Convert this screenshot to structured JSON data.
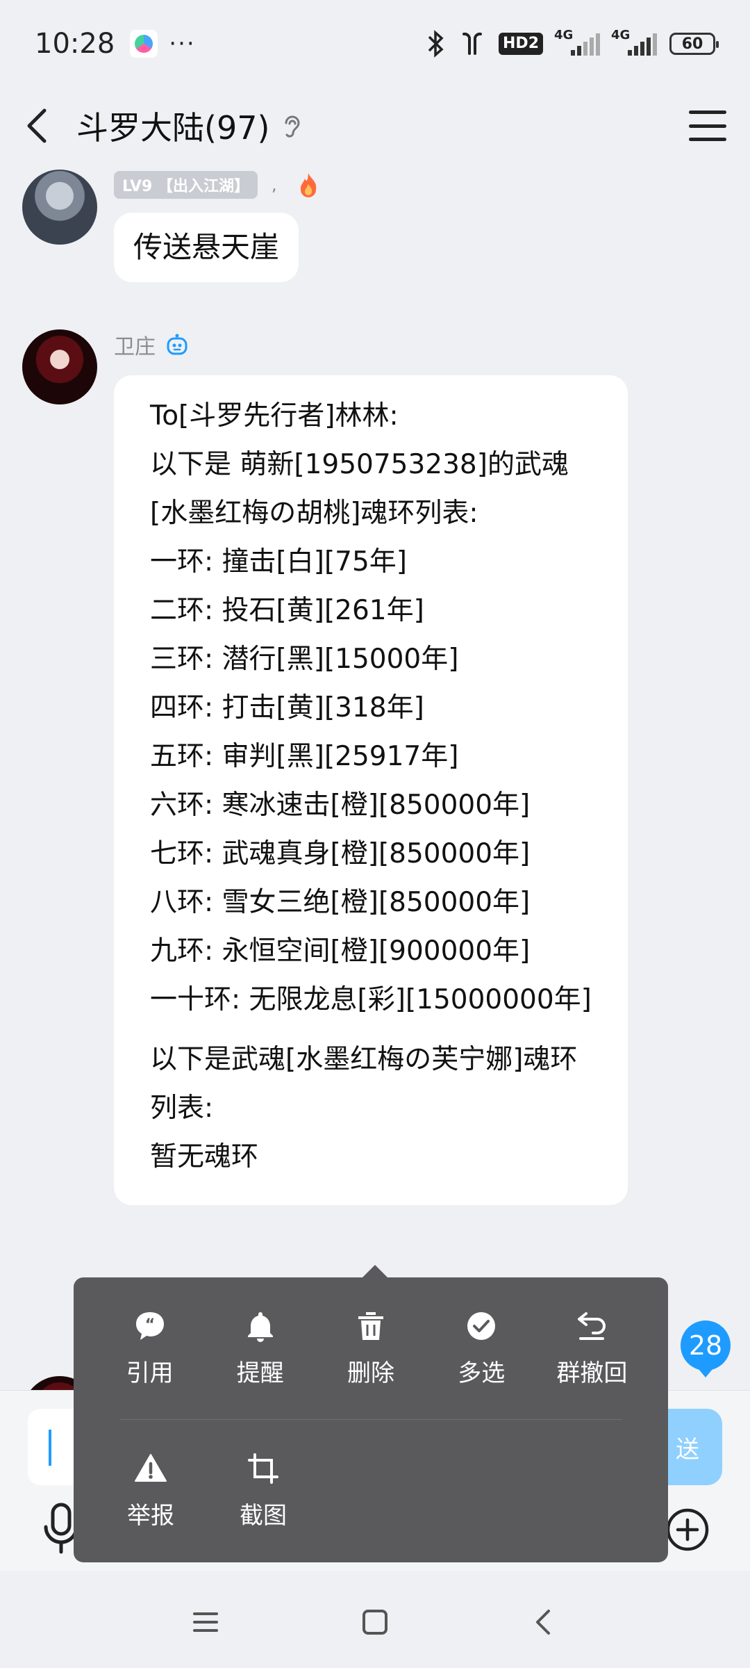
{
  "status_bar": {
    "time": "10:28",
    "dots": "···",
    "hd_label": "HD2",
    "signal1_label": "4G",
    "signal2_label": "4G",
    "battery": "60"
  },
  "header": {
    "title": "斗罗大陆(97)"
  },
  "messages": [
    {
      "level_badge": "LV9 【出入江湖】",
      "meta_sep": ",",
      "text": "传送悬天崖"
    },
    {
      "sender": "卫庄",
      "lines": [
        "To[斗罗先行者]林林:",
        "以下是 萌新[1950753238]的武魂[水墨红梅の胡桃]魂环列表:",
        "一环: 撞击[白][75年]",
        "二环: 投石[黄][261年]",
        "三环: 潜行[黑][15000年]",
        "四环: 打击[黄][318年]",
        "五环: 审判[黑][25917年]",
        "六环: 寒冰速击[橙][850000年]",
        "七环: 武魂真身[橙][850000年]",
        "八环: 雪女三绝[橙][850000年]",
        "九环: 永恒空间[橙][900000年]",
        "一十环: 无限龙息[彩][15000000年]",
        "以下是武魂[水墨红梅の芙宁娜]魂环列表:",
        "暂无魂环"
      ]
    }
  ],
  "unread_count": "28",
  "input": {
    "send_label": "送"
  },
  "context_menu": {
    "row1": [
      "引用",
      "提醒",
      "删除",
      "多选",
      "群撤回"
    ],
    "row2": [
      "举报",
      "截图"
    ]
  },
  "colors": {
    "accent": "#1e9bff",
    "menu_bg": "#5a5a5c",
    "background": "#eef0f3"
  }
}
